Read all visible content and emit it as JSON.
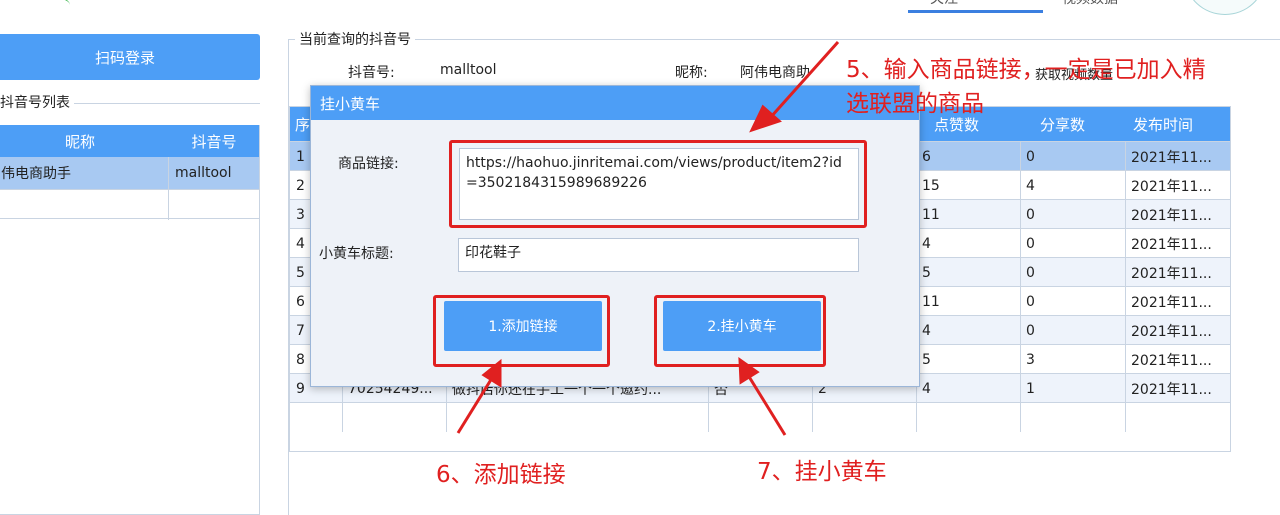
{
  "top_tabs": {
    "right_tab_label": "视频数据",
    "left_tab_label": "关注"
  },
  "left_panel": {
    "scan_login_label": "扫码登录",
    "account_list_label": "抖音号列表",
    "columns": [
      "昵称",
      "抖音号"
    ],
    "rows": [
      {
        "nickname": "伟电商助手",
        "douyin_id": "malltool"
      }
    ]
  },
  "current_account": {
    "group_label": "当前查询的抖音号",
    "douyin_id_label": "抖音号:",
    "douyin_id_value": "malltool",
    "nickname_label": "昵称:",
    "nickname_value": "阿伟电商助",
    "video_count_label": "获取视频数量"
  },
  "video_table": {
    "columns": [
      "序",
      "",
      "",
      "",
      "",
      "点赞数",
      "分享数",
      "发布时间"
    ],
    "row_numbers": [
      "1",
      "2",
      "3",
      "4",
      "5",
      "6",
      "7",
      "8",
      "9"
    ],
    "likes": [
      "6",
      "15",
      "11",
      "4",
      "5",
      "11",
      "4",
      "5",
      "4"
    ],
    "shares": [
      "0",
      "4",
      "0",
      "0",
      "0",
      "0",
      "0",
      "3",
      "1"
    ],
    "dates": [
      "2021年11...",
      "2021年11...",
      "2021年11...",
      "2021年11...",
      "2021年11...",
      "2021年11...",
      "2021年11...",
      "2021年11...",
      "2021年11..."
    ],
    "row9": {
      "id": "70254249...",
      "title": "做抖店你还在手工一个一个邀约...",
      "flag": "否",
      "comments": "2"
    }
  },
  "dialog": {
    "title": "挂小黄车",
    "product_link_label": "商品链接:",
    "product_link_value": "https://haohuo.jinritemai.com/views/product/item2?id=3502184315989689226",
    "cart_title_label": "小黄车标题:",
    "cart_title_value": "印花鞋子",
    "add_link_button": "1.添加链接",
    "hang_cart_button": "2.挂小黄车"
  },
  "annotations": {
    "step5_line1": "5、输入商品链接，一定是已加入精",
    "step5_line2": "选联盟的商品",
    "step6": "6、添加链接",
    "step7": "7、挂小黄车"
  },
  "colors": {
    "accent": "#4d9ef6",
    "selected_row": "#a8c9f2",
    "annotation": "#e02020"
  }
}
